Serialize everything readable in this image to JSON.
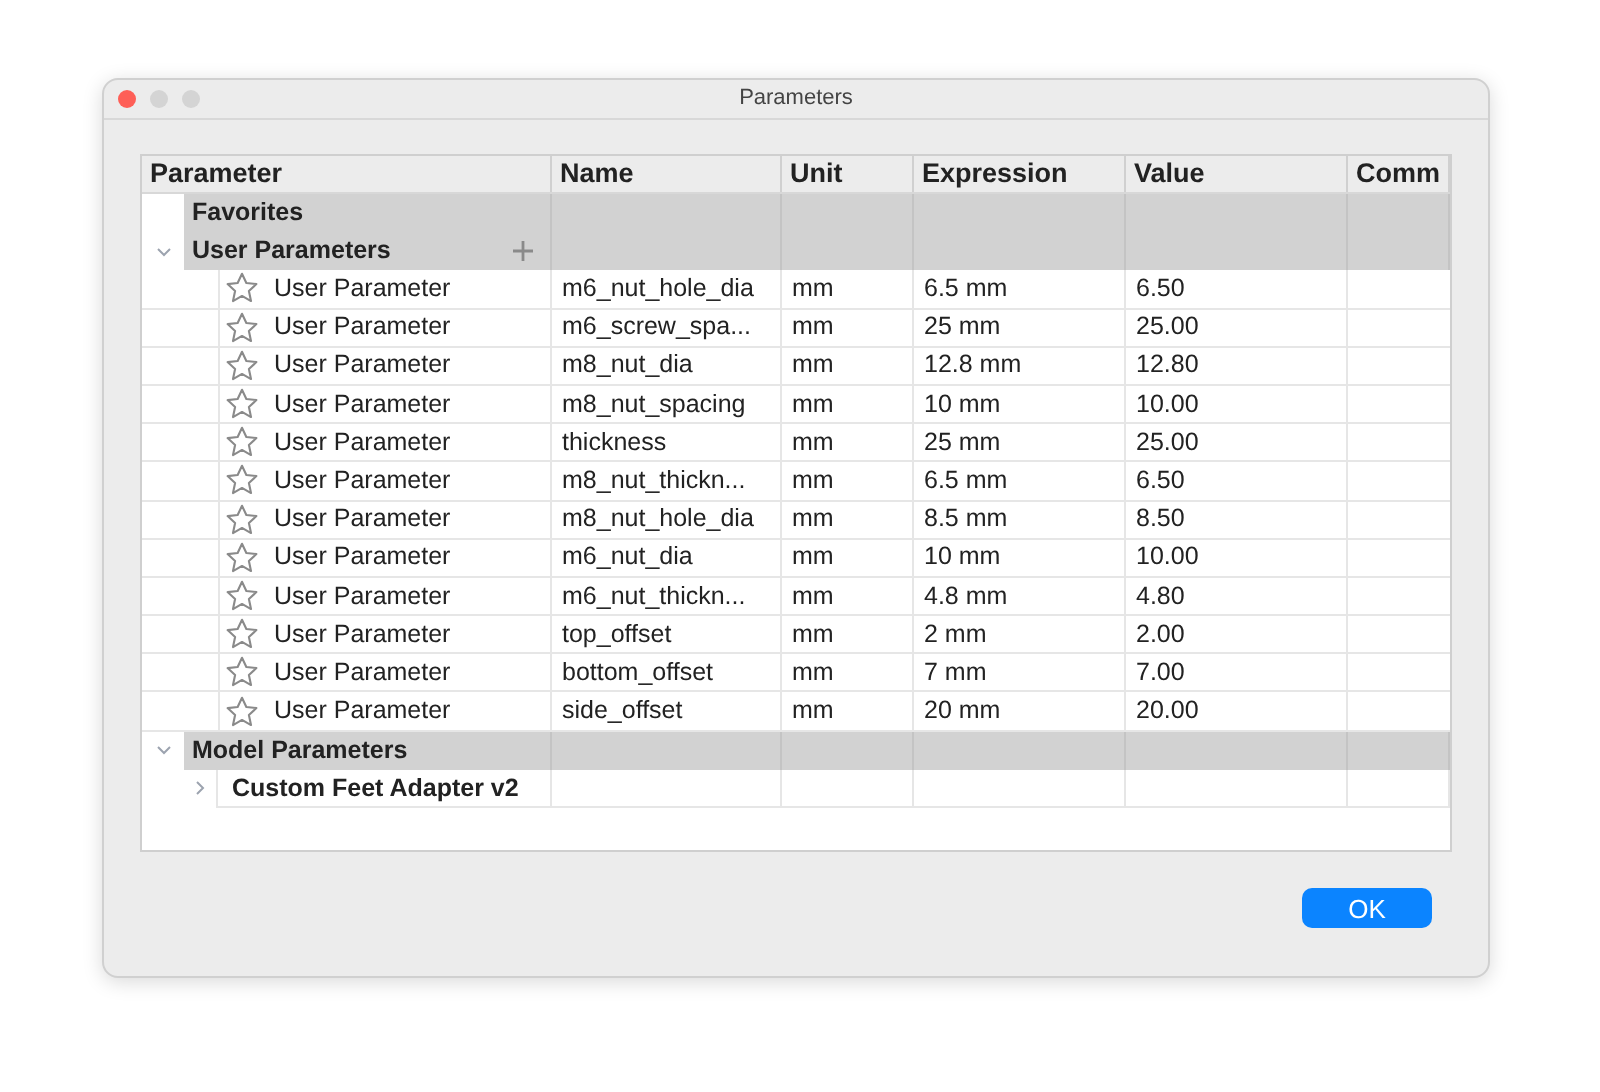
{
  "window": {
    "title": "Parameters"
  },
  "columns": [
    "Parameter",
    "Name",
    "Unit",
    "Expression",
    "Value",
    "Comm"
  ],
  "tree": [
    {
      "kind": "group",
      "label": "Favorites"
    },
    {
      "kind": "group",
      "label": "User Parameters",
      "expanded": true,
      "can_add": true,
      "children": [
        {
          "kind": "parameter",
          "parameter": "User Parameter",
          "favorite": false,
          "name": "m6_nut_hole_dia",
          "unit": "mm",
          "expression": "6.5 mm",
          "value": "6.50"
        },
        {
          "kind": "parameter",
          "parameter": "User Parameter",
          "favorite": false,
          "name": "m6_screw_spa...",
          "unit": "mm",
          "expression": "25 mm",
          "value": "25.00"
        },
        {
          "kind": "parameter",
          "parameter": "User Parameter",
          "favorite": false,
          "name": "m8_nut_dia",
          "unit": "mm",
          "expression": "12.8 mm",
          "value": "12.80"
        },
        {
          "kind": "parameter",
          "parameter": "User Parameter",
          "favorite": false,
          "name": "m8_nut_spacing",
          "unit": "mm",
          "expression": "10 mm",
          "value": "10.00"
        },
        {
          "kind": "parameter",
          "parameter": "User Parameter",
          "favorite": false,
          "name": "thickness",
          "unit": "mm",
          "expression": "25 mm",
          "value": "25.00"
        },
        {
          "kind": "parameter",
          "parameter": "User Parameter",
          "favorite": false,
          "name": "m8_nut_thickn...",
          "unit": "mm",
          "expression": "6.5 mm",
          "value": "6.50"
        },
        {
          "kind": "parameter",
          "parameter": "User Parameter",
          "favorite": false,
          "name": "m8_nut_hole_dia",
          "unit": "mm",
          "expression": "8.5 mm",
          "value": "8.50"
        },
        {
          "kind": "parameter",
          "parameter": "User Parameter",
          "favorite": false,
          "name": "m6_nut_dia",
          "unit": "mm",
          "expression": "10 mm",
          "value": "10.00"
        },
        {
          "kind": "parameter",
          "parameter": "User Parameter",
          "favorite": false,
          "name": "m6_nut_thickn...",
          "unit": "mm",
          "expression": "4.8 mm",
          "value": "4.80"
        },
        {
          "kind": "parameter",
          "parameter": "User Parameter",
          "favorite": false,
          "name": "top_offset",
          "unit": "mm",
          "expression": "2 mm",
          "value": "2.00"
        },
        {
          "kind": "parameter",
          "parameter": "User Parameter",
          "favorite": false,
          "name": "bottom_offset",
          "unit": "mm",
          "expression": "7 mm",
          "value": "7.00"
        },
        {
          "kind": "parameter",
          "parameter": "User Parameter",
          "favorite": false,
          "name": "side_offset",
          "unit": "mm",
          "expression": "20 mm",
          "value": "20.00"
        }
      ]
    },
    {
      "kind": "group",
      "label": "Model Parameters",
      "expanded": true,
      "children": [
        {
          "kind": "component",
          "label": "Custom Feet Adapter v2",
          "expanded": false
        }
      ]
    }
  ],
  "buttons": [
    "OK"
  ]
}
